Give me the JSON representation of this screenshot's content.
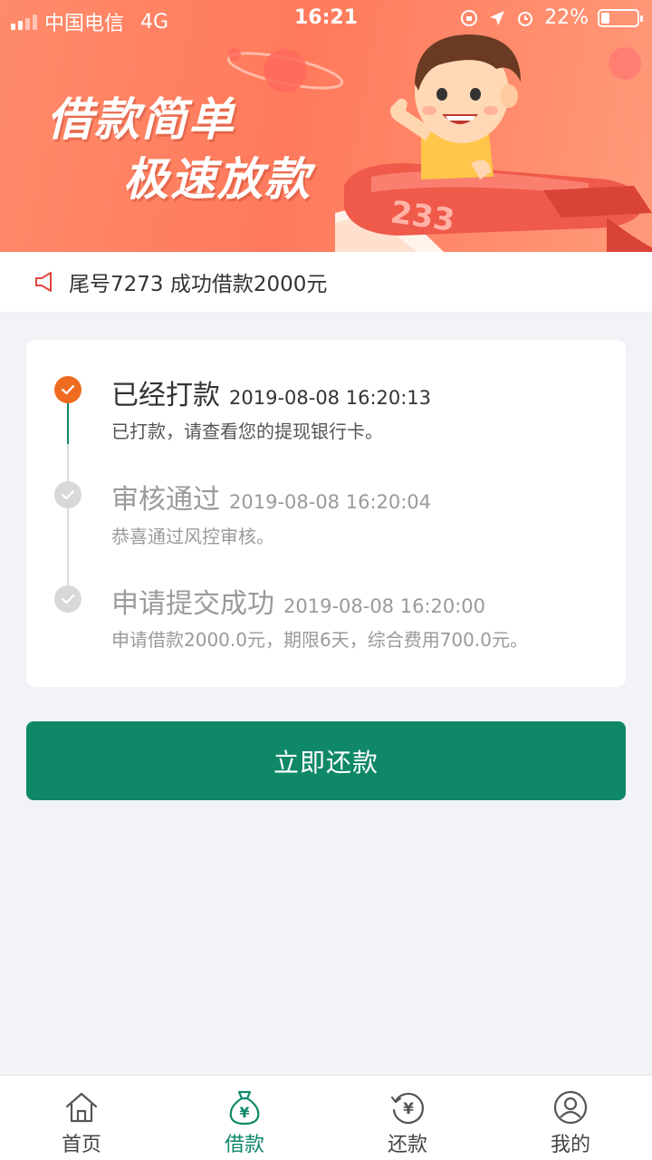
{
  "status_bar": {
    "carrier": "中国电信",
    "network": "4G",
    "time": "16:21",
    "battery": "22%"
  },
  "banner": {
    "line1": "借款简单",
    "line2": "极速放款",
    "plane_number": "233"
  },
  "notice": {
    "text": "尾号7273 成功借款2000元",
    "icon": "megaphone-icon"
  },
  "progress": {
    "steps": [
      {
        "title": "已经打款",
        "time": "2019-08-08 16:20:13",
        "desc": "已打款，请查看您的提现银行卡。",
        "state": "active"
      },
      {
        "title": "审核通过",
        "time": "2019-08-08 16:20:04",
        "desc": "恭喜通过风控审核。",
        "state": "done"
      },
      {
        "title": "申请提交成功",
        "time": "2019-08-08 16:20:00",
        "desc": "申请借款2000.0元，期限6天，综合费用700.0元。",
        "state": "done"
      }
    ]
  },
  "repay_button": {
    "label": "立即还款"
  },
  "tabbar": {
    "items": [
      {
        "label": "首页",
        "icon": "home-icon",
        "active": false
      },
      {
        "label": "借款",
        "icon": "money-bag-icon",
        "active": true
      },
      {
        "label": "还款",
        "icon": "repay-cycle-icon",
        "active": false
      },
      {
        "label": "我的",
        "icon": "user-icon",
        "active": false
      }
    ]
  },
  "colors": {
    "accent": "#0f8868",
    "active_step": "#ef6b1f",
    "banner": "#ff7a5c"
  }
}
